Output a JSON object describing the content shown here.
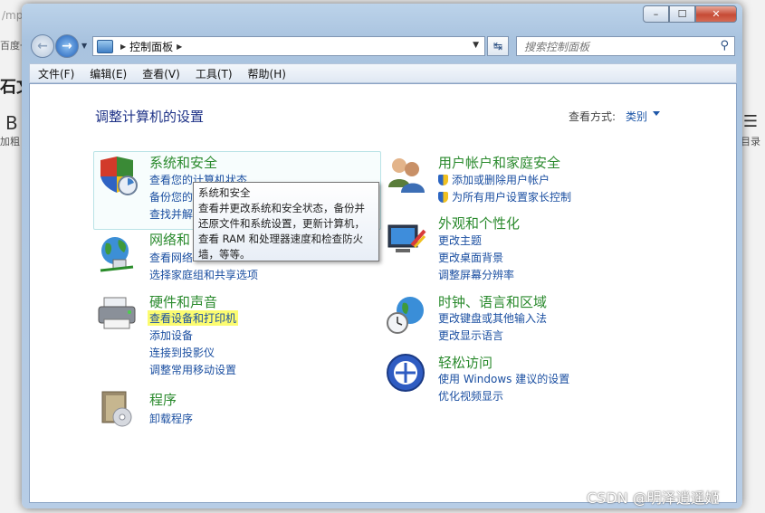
{
  "background": {
    "url_fragment": "/mp",
    "baidu_fragment": "百度一",
    "wen": "石文",
    "bold_b": "B",
    "jiacu": "加粗",
    "mulu": "目录"
  },
  "window": {
    "controls": {
      "minimize": "–",
      "maximize": "☐",
      "close": "✕"
    }
  },
  "address_bar": {
    "breadcrumb": "控制面板",
    "separator": "▶"
  },
  "search": {
    "placeholder": "搜索控制面板"
  },
  "menu": [
    "文件(F)",
    "编辑(E)",
    "查看(V)",
    "工具(T)",
    "帮助(H)"
  ],
  "content": {
    "title": "调整计算机的设置",
    "view_by_label": "查看方式:",
    "view_by_value": "类别"
  },
  "categories": {
    "system_security": {
      "title": "系统和安全",
      "links": [
        "查看您的计算机状态",
        "备份您的",
        "查找并解"
      ]
    },
    "network": {
      "title": "网络和",
      "links": [
        "查看网络",
        "选择家庭组和共享选项"
      ]
    },
    "hardware": {
      "title": "硬件和声音",
      "links": [
        "查看设备和打印机",
        "添加设备",
        "连接到投影仪",
        "调整常用移动设置"
      ]
    },
    "programs": {
      "title": "程序",
      "links": [
        "卸载程序"
      ]
    },
    "user_accounts": {
      "title": "用户帐户和家庭安全",
      "links": [
        "添加或删除用户帐户",
        "为所有用户设置家长控制"
      ]
    },
    "appearance": {
      "title": "外观和个性化",
      "links": [
        "更改主题",
        "更改桌面背景",
        "调整屏幕分辨率"
      ]
    },
    "clock_region": {
      "title": "时钟、语言和区域",
      "links": [
        "更改键盘或其他输入法",
        "更改显示语言"
      ]
    },
    "ease_access": {
      "title": "轻松访问",
      "links": [
        "使用 Windows 建议的设置",
        "优化视频显示"
      ]
    }
  },
  "tooltip": {
    "title": "系统和安全",
    "body": "查看并更改系统和安全状态，备份并还原文件和系统设置，更新计算机，查看 RAM 和处理器速度和检查防火墙，等等。"
  },
  "watermark": "CSDN @明泽逍遥姬"
}
